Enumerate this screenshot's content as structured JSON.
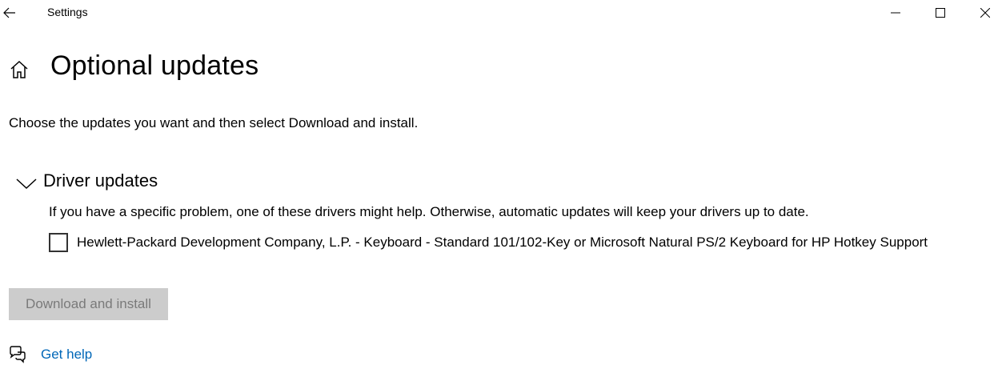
{
  "window": {
    "app_title": "Settings"
  },
  "page": {
    "title": "Optional updates",
    "subtitle": "Choose the updates you want and then select Download and install."
  },
  "driver_section": {
    "title": "Driver updates",
    "expanded": true,
    "description": "If you have a specific problem, one of these drivers might help. Otherwise, automatic updates will keep your drivers up to date.",
    "items": [
      {
        "label": "Hewlett-Packard Development Company, L.P. - Keyboard - Standard 101/102-Key or Microsoft Natural PS/2 Keyboard for HP Hotkey Support",
        "checked": false
      }
    ]
  },
  "actions": {
    "download_label": "Download and install",
    "download_enabled": false
  },
  "help": {
    "link_label": "Get help"
  },
  "colors": {
    "link": "#0067b8",
    "disabled_button_bg": "#cccccc",
    "disabled_button_text": "#7a7a7a"
  }
}
